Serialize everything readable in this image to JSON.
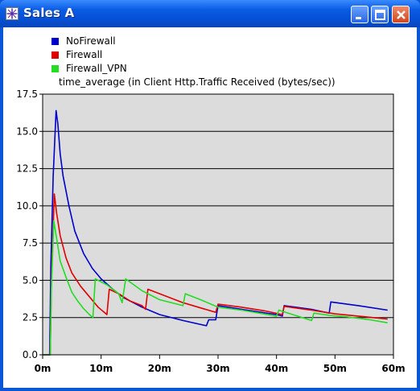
{
  "window": {
    "title": "Sales A",
    "controls": {
      "minimize": "minimize-icon",
      "maximize": "maximize-icon",
      "close": "close-icon"
    }
  },
  "colors": {
    "titlebar": "#0a5ce4",
    "plot_background": "#dcdcdc",
    "NoFirewall": "#0000cc",
    "Firewall": "#e00000",
    "Firewall_VPN": "#22dd22"
  },
  "chart_data": {
    "type": "line",
    "title": "time_average (in Client Http.Traffic Received (bytes/sec))",
    "xlabel": "",
    "ylabel": "",
    "xlim": [
      0,
      60
    ],
    "ylim": [
      0,
      17.5
    ],
    "x_ticks": [
      "0m",
      "10m",
      "20m",
      "30m",
      "40m",
      "50m",
      "60m"
    ],
    "y_ticks": [
      "0.0",
      "2.5",
      "5.0",
      "7.5",
      "10.0",
      "12.5",
      "15.0",
      "17.5"
    ],
    "grid": "horizontal",
    "legend_placement": "top-left",
    "series": [
      {
        "name": "NoFirewall",
        "color": "#0000cc",
        "points": [
          [
            0,
            0
          ],
          [
            1.2,
            0
          ],
          [
            1.4,
            6
          ],
          [
            1.8,
            12
          ],
          [
            2.3,
            16.4
          ],
          [
            2.6,
            15.5
          ],
          [
            3,
            13.5
          ],
          [
            3.5,
            12
          ],
          [
            4.5,
            10
          ],
          [
            5.5,
            8.3
          ],
          [
            7,
            6.8
          ],
          [
            8.5,
            5.8
          ],
          [
            10,
            5.1
          ],
          [
            12,
            4.4
          ],
          [
            14,
            3.8
          ],
          [
            17,
            3.2
          ],
          [
            20,
            2.7
          ],
          [
            24,
            2.3
          ],
          [
            28,
            1.95
          ],
          [
            28.4,
            2.35
          ],
          [
            29.6,
            2.35
          ],
          [
            30,
            3.3
          ],
          [
            35,
            3
          ],
          [
            40,
            2.7
          ],
          [
            41,
            2.6
          ],
          [
            41.3,
            3.3
          ],
          [
            46,
            3.05
          ],
          [
            49,
            2.8
          ],
          [
            49.3,
            3.55
          ],
          [
            54,
            3.3
          ],
          [
            59,
            3.0
          ]
        ]
      },
      {
        "name": "Firewall",
        "color": "#e00000",
        "points": [
          [
            0,
            0
          ],
          [
            1.3,
            0
          ],
          [
            1.5,
            5
          ],
          [
            2,
            10.8
          ],
          [
            2.4,
            9.5
          ],
          [
            3,
            8
          ],
          [
            4,
            6.5
          ],
          [
            5,
            5.5
          ],
          [
            6.5,
            4.6
          ],
          [
            8,
            3.9
          ],
          [
            9.5,
            3.2
          ],
          [
            11,
            2.7
          ],
          [
            11.4,
            4.4
          ],
          [
            13,
            4.1
          ],
          [
            15,
            3.6
          ],
          [
            17,
            3.3
          ],
          [
            17.6,
            3.05
          ],
          [
            18,
            4.4
          ],
          [
            21,
            3.95
          ],
          [
            24,
            3.5
          ],
          [
            27,
            3.15
          ],
          [
            29.6,
            2.85
          ],
          [
            30,
            3.4
          ],
          [
            34,
            3.2
          ],
          [
            38,
            2.95
          ],
          [
            41,
            2.7
          ],
          [
            41.3,
            3.25
          ],
          [
            46,
            3.0
          ],
          [
            50,
            2.75
          ],
          [
            54,
            2.6
          ],
          [
            59,
            2.4
          ]
        ]
      },
      {
        "name": "Firewall_VPN",
        "color": "#22dd22",
        "points": [
          [
            0,
            0
          ],
          [
            1.3,
            0
          ],
          [
            1.5,
            4.5
          ],
          [
            1.9,
            9
          ],
          [
            2.4,
            7.8
          ],
          [
            3,
            6.3
          ],
          [
            4,
            5.2
          ],
          [
            5,
            4.2
          ],
          [
            6,
            3.6
          ],
          [
            7,
            3.1
          ],
          [
            8,
            2.7
          ],
          [
            8.6,
            2.5
          ],
          [
            9,
            5.1
          ],
          [
            11,
            4.7
          ],
          [
            13,
            4.1
          ],
          [
            13.6,
            3.5
          ],
          [
            14.2,
            5.1
          ],
          [
            17,
            4.3
          ],
          [
            20,
            3.7
          ],
          [
            24,
            3.3
          ],
          [
            24.4,
            4.1
          ],
          [
            27,
            3.7
          ],
          [
            30,
            3.2
          ],
          [
            34,
            3.0
          ],
          [
            37,
            2.8
          ],
          [
            40,
            2.6
          ],
          [
            40.4,
            3.0
          ],
          [
            42,
            2.8
          ],
          [
            46,
            2.3
          ],
          [
            46.4,
            2.8
          ],
          [
            49,
            2.65
          ],
          [
            52,
            2.55
          ],
          [
            56,
            2.35
          ],
          [
            59,
            2.15
          ]
        ]
      }
    ]
  }
}
